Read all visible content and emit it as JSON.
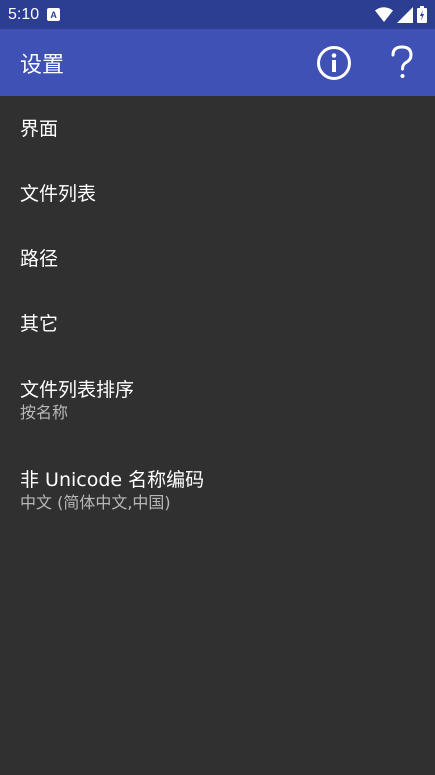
{
  "status_bar": {
    "time": "5:10",
    "notification_icon": "A"
  },
  "app_bar": {
    "title": "设置",
    "actions": [
      "info-icon",
      "help-icon"
    ]
  },
  "settings": [
    {
      "title": "界面"
    },
    {
      "title": "文件列表"
    },
    {
      "title": "路径"
    },
    {
      "title": "其它"
    },
    {
      "title": "文件列表排序",
      "summary": "按名称"
    },
    {
      "title": "非 Unicode 名称编码",
      "summary": "中文 (简体中文,中国)"
    }
  ],
  "colors": {
    "status_bar": "#2c3e92",
    "app_bar": "#3f51b5",
    "background": "#303030",
    "summary_text": "#b8b8b8"
  }
}
